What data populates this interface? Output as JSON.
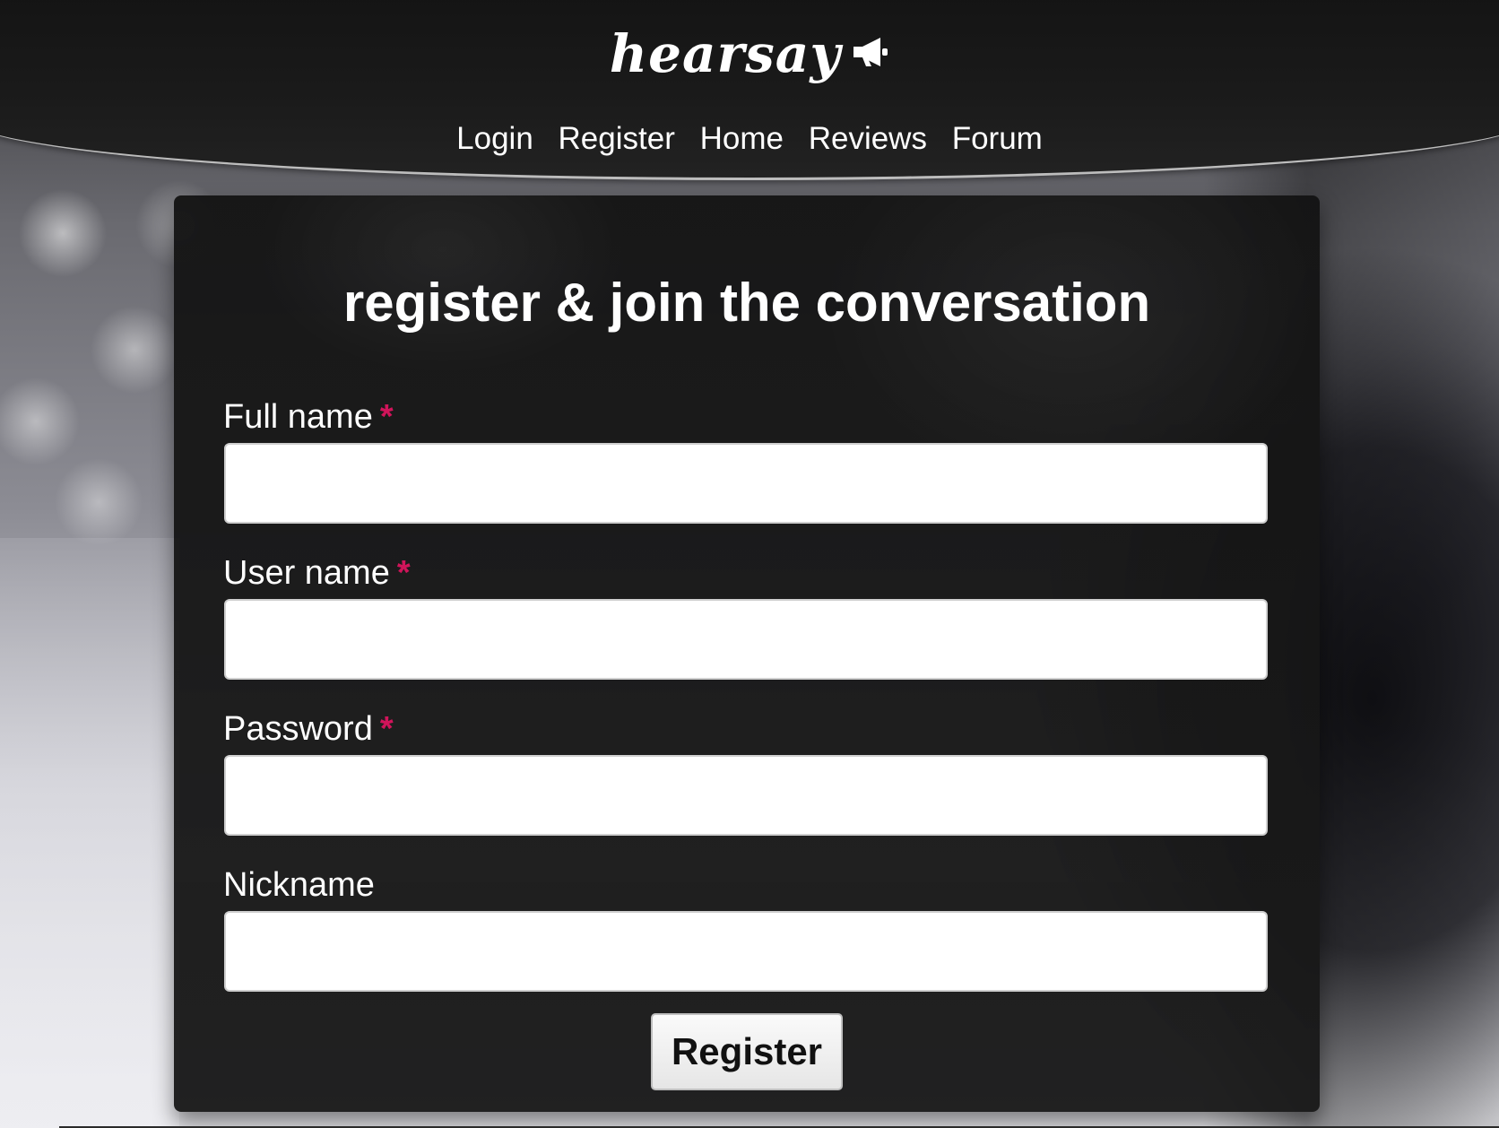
{
  "brand": {
    "logo_text": "hearsay",
    "logo_icon": "megaphone-icon"
  },
  "nav": {
    "items": [
      "Login",
      "Register",
      "Home",
      "Reviews",
      "Forum"
    ]
  },
  "form": {
    "title": "register & join the conversation",
    "required_marker": "*",
    "fields": [
      {
        "label": "Full name",
        "required": true,
        "value": ""
      },
      {
        "label": "User name",
        "required": true,
        "value": ""
      },
      {
        "label": "Password",
        "required": true,
        "value": ""
      },
      {
        "label": "Nickname",
        "required": false,
        "value": ""
      }
    ],
    "submit_label": "Register"
  },
  "colors": {
    "required_marker": "#d0145a",
    "panel_bg": "#1a1a1a",
    "text": "#ffffff"
  }
}
